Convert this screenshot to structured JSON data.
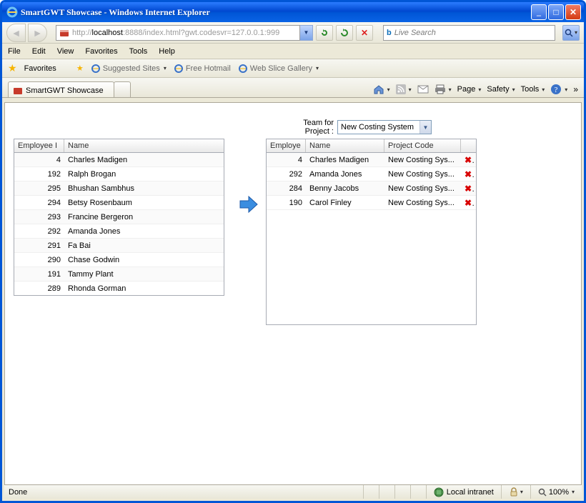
{
  "window_title": "SmartGWT Showcase - Windows Internet Explorer",
  "address": {
    "scheme": "http://",
    "host": "localhost",
    "rest": ":8888/index.html?gwt.codesvr=127.0.0.1:999"
  },
  "search_placeholder": "Live Search",
  "menubar": [
    "File",
    "Edit",
    "View",
    "Favorites",
    "Tools",
    "Help"
  ],
  "favrow": {
    "label": "Favorites",
    "links": [
      "Suggested Sites",
      "Free Hotmail",
      "Web Slice Gallery"
    ]
  },
  "tab_title": "SmartGWT Showcase",
  "tools": [
    "Page",
    "Safety",
    "Tools"
  ],
  "team_label": "Team for Project :",
  "project_selected": "New Costing System",
  "left_grid": {
    "columns": [
      "Employee I",
      "Name"
    ],
    "rows": [
      {
        "id": "4",
        "name": "Charles Madigen"
      },
      {
        "id": "192",
        "name": "Ralph Brogan"
      },
      {
        "id": "295",
        "name": "Bhushan Sambhus"
      },
      {
        "id": "294",
        "name": "Betsy Rosenbaum"
      },
      {
        "id": "293",
        "name": "Francine Bergeron"
      },
      {
        "id": "292",
        "name": "Amanda Jones"
      },
      {
        "id": "291",
        "name": "Fa Bai"
      },
      {
        "id": "290",
        "name": "Chase Godwin"
      },
      {
        "id": "191",
        "name": "Tammy Plant"
      },
      {
        "id": "289",
        "name": "Rhonda Gorman"
      }
    ]
  },
  "right_grid": {
    "columns": [
      "Employe",
      "Name",
      "Project Code"
    ],
    "rows": [
      {
        "id": "4",
        "name": "Charles Madigen",
        "proj": "New Costing Sys..."
      },
      {
        "id": "292",
        "name": "Amanda Jones",
        "proj": "New Costing Sys..."
      },
      {
        "id": "284",
        "name": "Benny Jacobs",
        "proj": "New Costing Sys..."
      },
      {
        "id": "190",
        "name": "Carol Finley",
        "proj": "New Costing Sys..."
      }
    ]
  },
  "status": {
    "done": "Done",
    "zone": "Local intranet",
    "zoom": "100%"
  }
}
